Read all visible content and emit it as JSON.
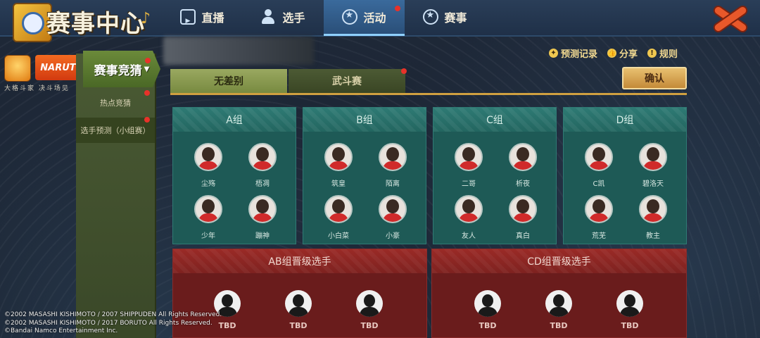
{
  "header": {
    "title": "赛事中心",
    "tabs": [
      {
        "label": "直播",
        "icon": "tv-icon",
        "active": false,
        "badge": false
      },
      {
        "label": "选手",
        "icon": "player-icon",
        "active": false,
        "badge": false
      },
      {
        "label": "活动",
        "icon": "star-badge-icon",
        "active": true,
        "badge": true
      },
      {
        "label": "赛事",
        "icon": "star-badge-icon",
        "active": false,
        "badge": false
      }
    ]
  },
  "brand": {
    "logo_text": "NARUTO",
    "subtitle": "大格斗家  决斗场见"
  },
  "sidebar": {
    "title": "赛事竞猜",
    "items": [
      {
        "label": "热点竞猜"
      },
      {
        "label": "选手预测（小组赛）"
      }
    ]
  },
  "toolbar": {
    "links": [
      {
        "label": "预测记录",
        "icon": "medal-icon"
      },
      {
        "label": "分享",
        "icon": "thumb-icon"
      },
      {
        "label": "规则",
        "icon": "info-icon"
      }
    ],
    "confirm_label": "确认"
  },
  "modes": [
    {
      "label": "无差别",
      "active": true
    },
    {
      "label": "武斗赛",
      "active": false
    }
  ],
  "groups": [
    {
      "name": "A组",
      "players": [
        "尘殇",
        "梧凋",
        "少年",
        "蹦神"
      ]
    },
    {
      "name": "B组",
      "players": [
        "筑皇",
        "陌离",
        "小白菜",
        "小豪"
      ]
    },
    {
      "name": "C组",
      "players": [
        "二哥",
        "析夜",
        "友人",
        "真白"
      ]
    },
    {
      "name": "D组",
      "players": [
        "C凯",
        "碧洛天",
        "荒芜",
        "教主"
      ]
    }
  ],
  "advance": [
    {
      "title": "AB组晋级选手",
      "slots": [
        "TBD",
        "TBD",
        "TBD"
      ]
    },
    {
      "title": "CD组晋级选手",
      "slots": [
        "TBD",
        "TBD",
        "TBD"
      ]
    }
  ],
  "copyright": [
    "©2002 MASASHI KISHIMOTO / 2007 SHIPPUDEN All Rights Reserved.",
    "©2002 MASASHI KISHIMOTO / 2017 BORUTO All Rights Reserved.",
    "©Bandai Namco Entertainment Inc."
  ],
  "colors": {
    "accent_gold": "#d0a040",
    "group_teal": "#1e5a56",
    "advance_red": "#6a1c1c",
    "badge_red": "#e8322a"
  }
}
